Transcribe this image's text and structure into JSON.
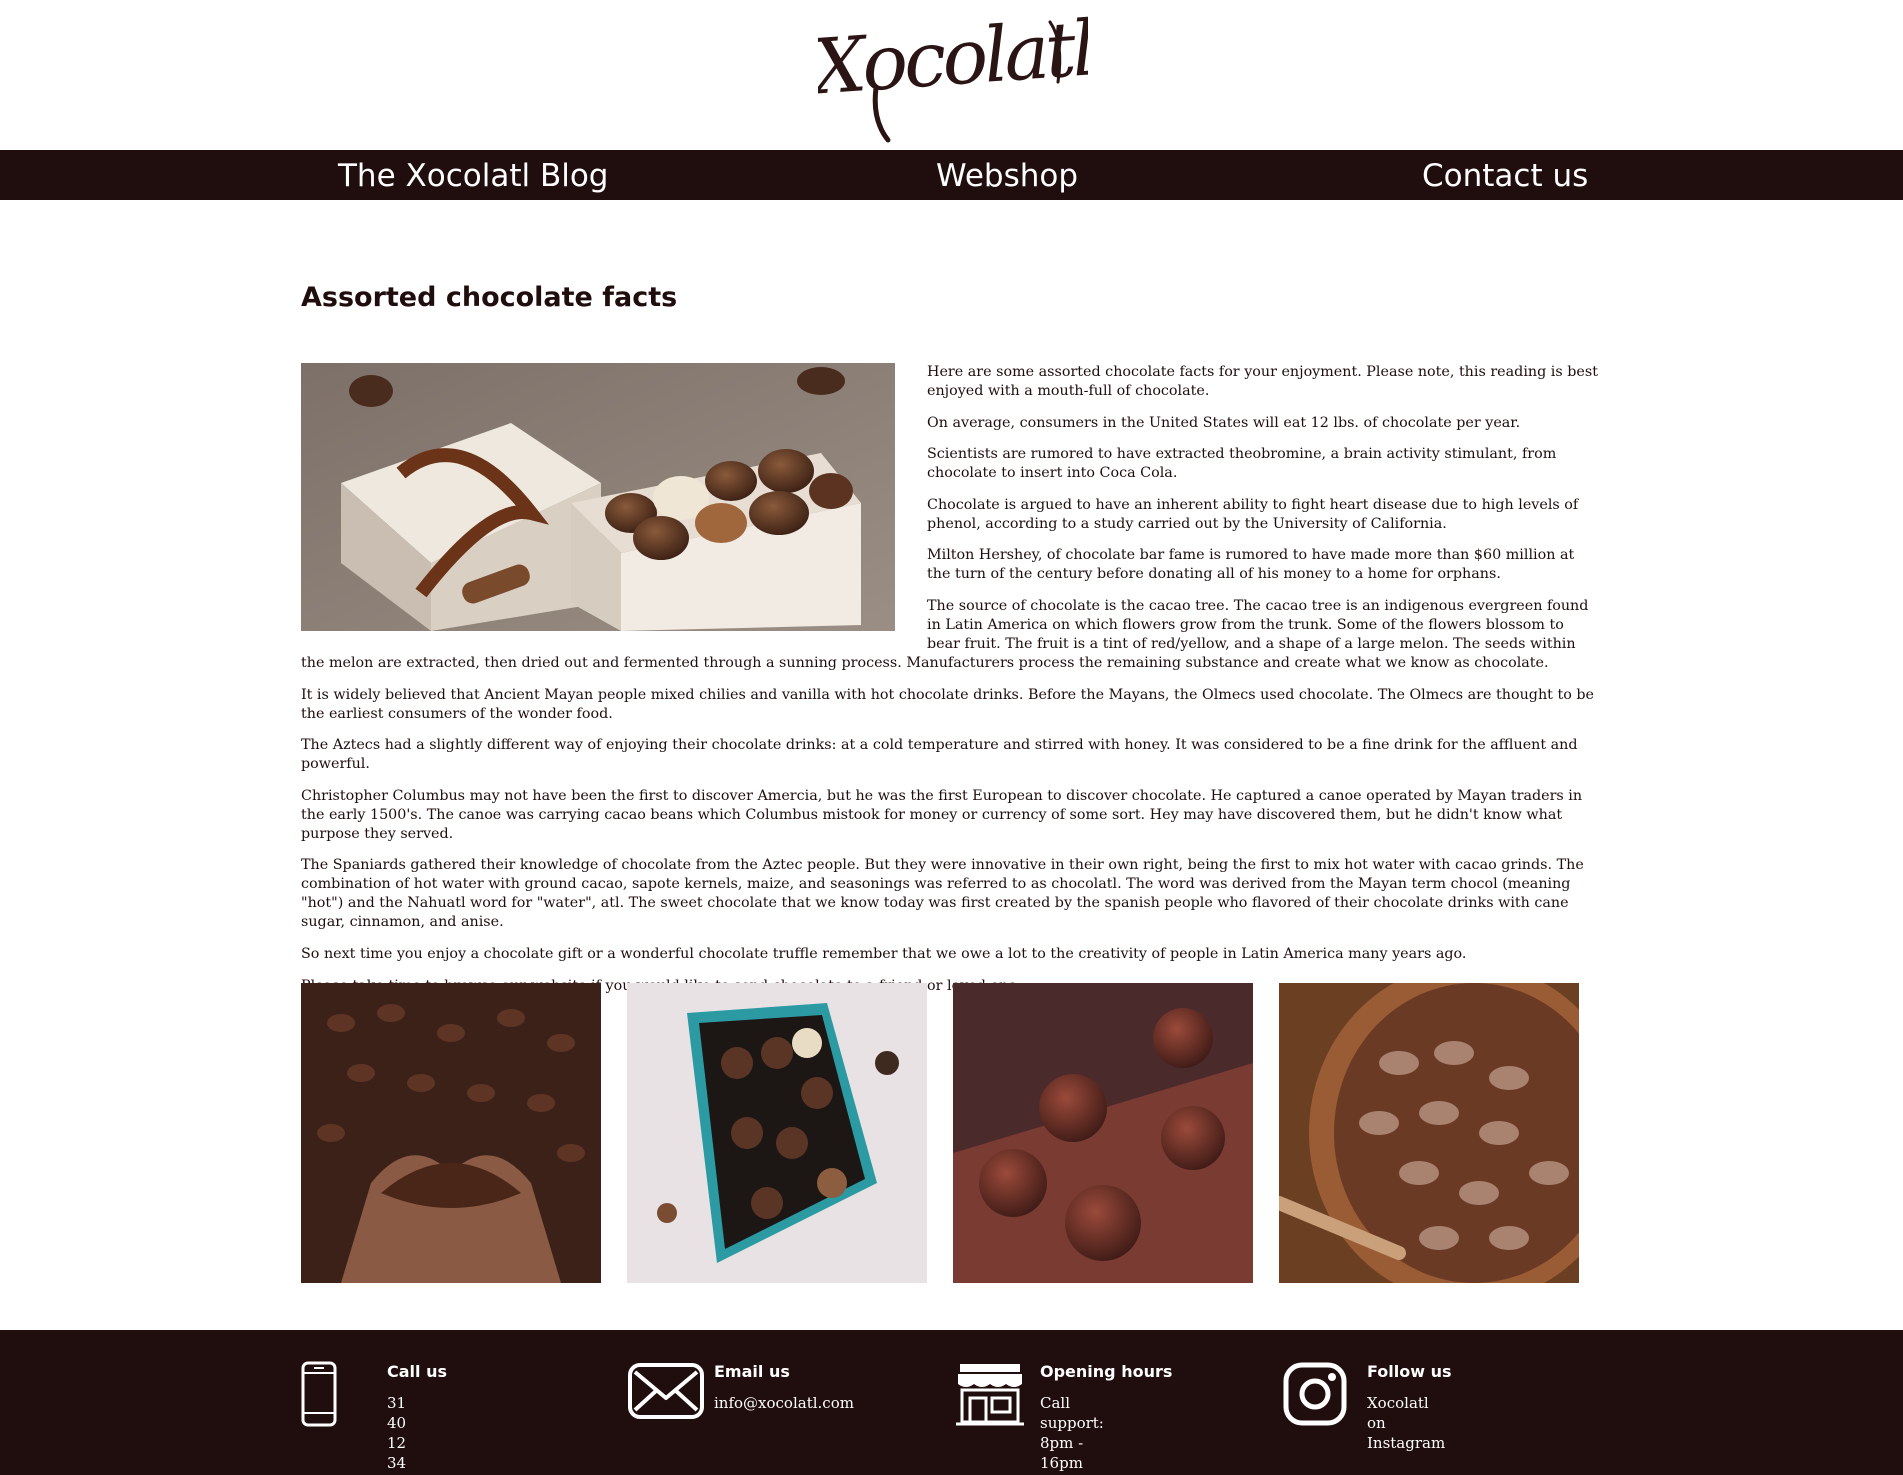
{
  "brand": {
    "logo_text": "Xocolatl"
  },
  "nav": {
    "items": [
      {
        "label": "The Xocolatl Blog"
      },
      {
        "label": "Webshop"
      },
      {
        "label": "Contact us"
      }
    ]
  },
  "article": {
    "title": "Assorted chocolate facts",
    "hero_image": "chocolate-gift-box-photo",
    "paragraphs": [
      "Here are some assorted chocolate facts for your enjoyment. Please note, this reading is best enjoyed with a mouth-full of chocolate.",
      "On average, consumers in the United States will eat 12 lbs. of chocolate per year.",
      "Scientists are rumored to have extracted theobromine, a brain activity stimulant, from chocolate to insert into Coca Cola.",
      "Chocolate is argued to have an inherent ability to fight heart disease due to high levels of phenol, according to a study carried out by the University of California.",
      "Milton Hershey, of chocolate bar fame is rumored to have made more than $60 million at the turn of the century before donating all of his money to a home for orphans.",
      "The source of chocolate is the cacao tree. The cacao tree is an indigenous evergreen found in Latin America on which flowers grow from the trunk. Some of the flowers blossom to bear fruit. The fruit is a tint of red/yellow, and a shape of a large melon. The seeds within the melon are extracted, then dried out and fermented through a sunning process. Manufacturers process the remaining substance and create what we know as chocolate.",
      "It is widely believed that Ancient Mayan people mixed chilies and vanilla with hot chocolate drinks. Before the Mayans, the Olmecs used chocolate. The Olmecs are thought to be the earliest consumers of the wonder food.",
      "The Aztecs had a slightly different way of enjoying their chocolate drinks: at a cold temperature and stirred with honey. It was considered to be a fine drink for the affluent and powerful.",
      "Christopher Columbus may not have been the first to discover Amercia, but he was the first European to discover chocolate. He captured a canoe operated by Mayan traders in the early 1500's. The canoe was carrying cacao beans which Columbus mistook for money or currency of some sort. Hey may have discovered them, but he didn't know what purpose they served.",
      "The Spaniards gathered their knowledge of chocolate from the Aztec people. But they were innovative in their own right, being the first to mix hot water with cacao grinds. The combination of hot water with ground cacao, sapote kernels, maize, and seasonings was referred to as chocolatl. The word was derived from the Mayan term chocol (meaning \"hot\") and the Nahuatl word for \"water\", atl. The sweet chocolate that we know today was first created by the spanish people who flavored of their chocolate drinks with cane sugar, cinnamon, and anise.",
      "So next time you enjoy a chocolate gift or a wonderful chocolate truffle remember that we owe a lot to the creativity of people in Latin America many years ago.",
      "Please take time to browse our website if you would like to send chocolate to a friend or loved one."
    ]
  },
  "gallery": [
    {
      "image": "cocoa-beans-in-hands-photo"
    },
    {
      "image": "chocolate-box-assortment-photo"
    },
    {
      "image": "cocoa-truffles-photo"
    },
    {
      "image": "cacao-beans-bowl-photo"
    }
  ],
  "footer": {
    "columns": [
      {
        "icon": "phone-icon",
        "title": "Call us",
        "text": "31 40 12 34"
      },
      {
        "icon": "envelope-icon",
        "title": "Email us",
        "text": "info@xocolatl.com"
      },
      {
        "icon": "shop-icon",
        "title": "Opening hours",
        "text": "Call support:\n8pm - 16pm"
      },
      {
        "icon": "instagram-icon",
        "title": "Follow us",
        "text": "Xocolatl on Instagram"
      }
    ]
  },
  "colors": {
    "brand_dark": "#200d0d",
    "background": "#ffffff",
    "footer_text": "#ffffff"
  }
}
